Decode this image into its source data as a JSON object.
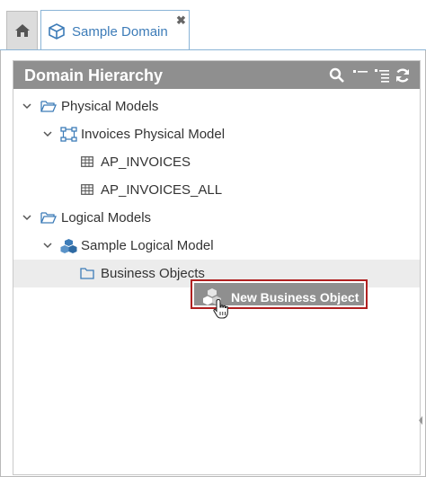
{
  "tabs": [
    {
      "id": "home",
      "icon": "home-icon"
    },
    {
      "id": "sample-domain",
      "label": "Sample Domain",
      "icon": "domain-icon",
      "close_icon": "close-icon"
    }
  ],
  "panel": {
    "title": "Domain Hierarchy",
    "toolbar_icons": [
      "search-icon",
      "collapse-all-icon",
      "expand-all-icon",
      "refresh-icon"
    ]
  },
  "tree": [
    {
      "label": "Physical Models",
      "icon": "folder-open-icon",
      "expanded": true,
      "level": 0
    },
    {
      "label": "Invoices Physical Model",
      "icon": "physical-model-icon",
      "expanded": true,
      "level": 1
    },
    {
      "label": "AP_INVOICES",
      "icon": "table-icon",
      "level": 2
    },
    {
      "label": "AP_INVOICES_ALL",
      "icon": "table-icon",
      "level": 2
    },
    {
      "label": "Logical Models",
      "icon": "folder-open-icon",
      "expanded": true,
      "level": 0
    },
    {
      "label": "Sample Logical Model",
      "icon": "logical-model-icon",
      "expanded": true,
      "level": 1
    },
    {
      "label": "Business Objects",
      "icon": "folder-icon",
      "level": 2,
      "selected": true
    }
  ],
  "context_menu": {
    "label": "New Business Object",
    "icon": "business-object-icon"
  },
  "colors": {
    "accent": "#3d7cb8",
    "header_bg": "#8f8f8f",
    "highlight_border": "#b02020",
    "selected_row": "#ececec"
  }
}
